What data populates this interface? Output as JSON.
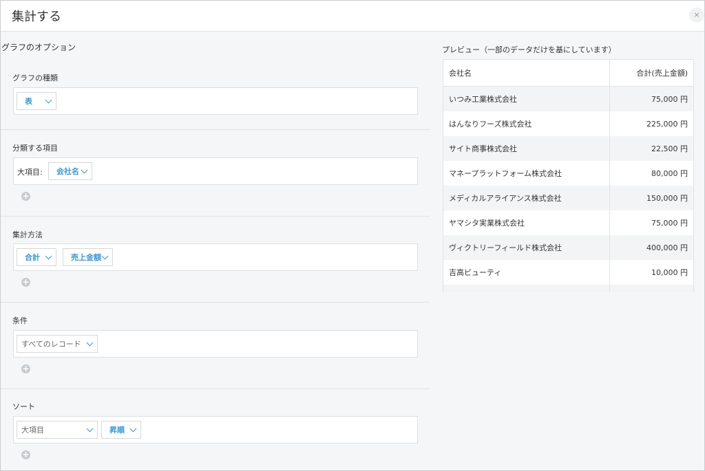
{
  "dialog": {
    "title": "集計する",
    "close_icon": "×"
  },
  "options": {
    "heading": "グラフのオプション",
    "chart_type": {
      "label": "グラフの種類",
      "value": "表"
    },
    "grouping": {
      "label": "分類する項目",
      "major_label": "大項目:",
      "major_value": "会社名"
    },
    "aggregation": {
      "label": "集計方法",
      "function": "合計",
      "field": "売上金額"
    },
    "condition": {
      "label": "条件",
      "value": "すべてのレコード"
    },
    "sort": {
      "label": "ソート",
      "field": "大項目",
      "order": "昇順"
    },
    "add_icon": "+"
  },
  "preview": {
    "heading": "プレビュー（一部のデータだけを基にしています）",
    "columns": [
      "会社名",
      "合計(売上金額)"
    ],
    "rows": [
      [
        "いつみ工業株式会社",
        "75,000 円"
      ],
      [
        "はんなりフーズ株式会社",
        "225,000 円"
      ],
      [
        "サイト商事株式会社",
        "22,500 円"
      ],
      [
        "マネープラットフォーム株式会社",
        "80,000 円"
      ],
      [
        "メディカルアライアンス株式会社",
        "150,000 円"
      ],
      [
        "ヤマシタ実業株式会社",
        "75,000 円"
      ],
      [
        "ヴィクトリーフィールド株式会社",
        "400,000 円"
      ],
      [
        "吉高ビューティ",
        "10,000 円"
      ],
      [
        "",
        ""
      ]
    ]
  },
  "colors": {
    "accent": "#3498db",
    "panel_border": "#dcdfe1",
    "background": "#f5f6f7"
  }
}
